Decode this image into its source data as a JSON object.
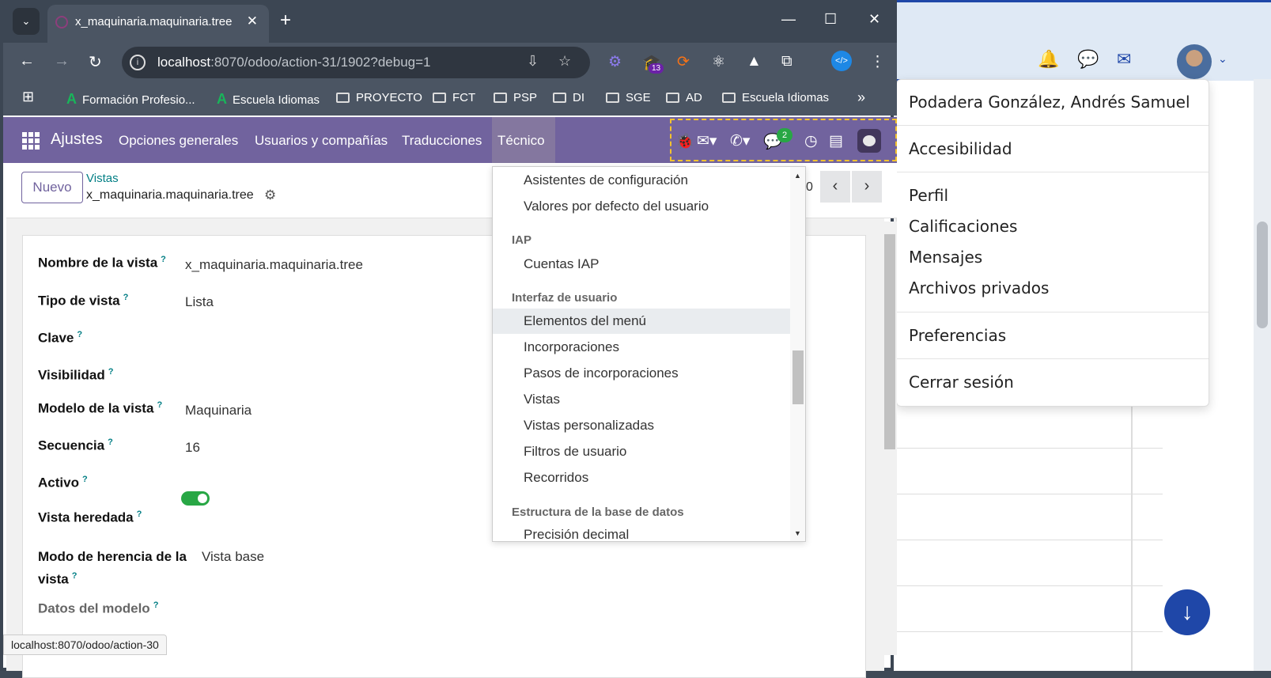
{
  "bg_app": {
    "icons": [
      "bell-icon",
      "chat-icon",
      "mail-icon"
    ]
  },
  "user_menu": {
    "name": "Podadera González, Andrés Samuel",
    "items": [
      "Accesibilidad",
      "Perfil",
      "Calificaciones",
      "Mensajes",
      "Archivos privados",
      "Preferencias",
      "Cerrar sesión"
    ]
  },
  "browser": {
    "tab_title": "x_maquinaria.maquinaria.tree",
    "url_host": "localhost",
    "url_rest": ":8070/odoo/action-31/1902?debug=1",
    "ext_badge": "13",
    "bookmarks": [
      "Formación Profesio...",
      "Escuela Idiomas",
      "PROYECTO",
      "FCT",
      "PSP",
      "DI",
      "SGE",
      "AD",
      "Escuela Idiomas"
    ],
    "status_url": "localhost:8070/odoo/action-30"
  },
  "odoo": {
    "app_name": "Ajustes",
    "menus": [
      "Opciones generales",
      "Usuarios y compañías",
      "Traducciones",
      "Técnico"
    ],
    "chat_badge": "2",
    "new_button": "Nuevo",
    "breadcrumb_parent": "Vistas",
    "breadcrumb_current": "x_maquinaria.maquinaria.tree",
    "pager_fragment": "0"
  },
  "form": {
    "fields": [
      {
        "label": "Nombre de la vista",
        "value": "x_maquinaria.maquinaria.tree"
      },
      {
        "label": "Tipo de vista",
        "value": "Lista"
      },
      {
        "label": "Clave",
        "value": ""
      },
      {
        "label": "Visibilidad",
        "value": ""
      },
      {
        "label": "Modelo de la vista",
        "value": "Maquinaria"
      },
      {
        "label": "Secuencia",
        "value": "16"
      },
      {
        "label": "Activo",
        "value": ""
      },
      {
        "label": "Vista heredada",
        "value": ""
      },
      {
        "label": "Modo de herencia de la",
        "label2": "vista",
        "value": "Vista base"
      },
      {
        "label": "Datos del modelo",
        "value": ""
      }
    ],
    "help_mark": "?",
    "active_toggle": true
  },
  "technical_menu": {
    "items": [
      {
        "type": "item",
        "text": "Asistentes de configuración"
      },
      {
        "type": "item",
        "text": "Valores por defecto del usuario"
      },
      {
        "type": "header",
        "text": "IAP"
      },
      {
        "type": "item",
        "text": "Cuentas IAP"
      },
      {
        "type": "header",
        "text": "Interfaz de usuario"
      },
      {
        "type": "item",
        "text": "Elementos del menú",
        "highlighted": true
      },
      {
        "type": "item",
        "text": "Incorporaciones"
      },
      {
        "type": "item",
        "text": "Pasos de incorporaciones"
      },
      {
        "type": "item",
        "text": "Vistas"
      },
      {
        "type": "item",
        "text": "Vistas personalizadas"
      },
      {
        "type": "item",
        "text": "Filtros de usuario"
      },
      {
        "type": "item",
        "text": "Recorridos"
      },
      {
        "type": "header",
        "text": "Estructura de la base de datos"
      },
      {
        "type": "item",
        "text": "Precisión decimal"
      }
    ]
  },
  "colors": {
    "odoo_purple": "#71639e",
    "accent_blue": "#1f47a8",
    "teal": "#017e84",
    "toggle_green": "#28a745"
  }
}
